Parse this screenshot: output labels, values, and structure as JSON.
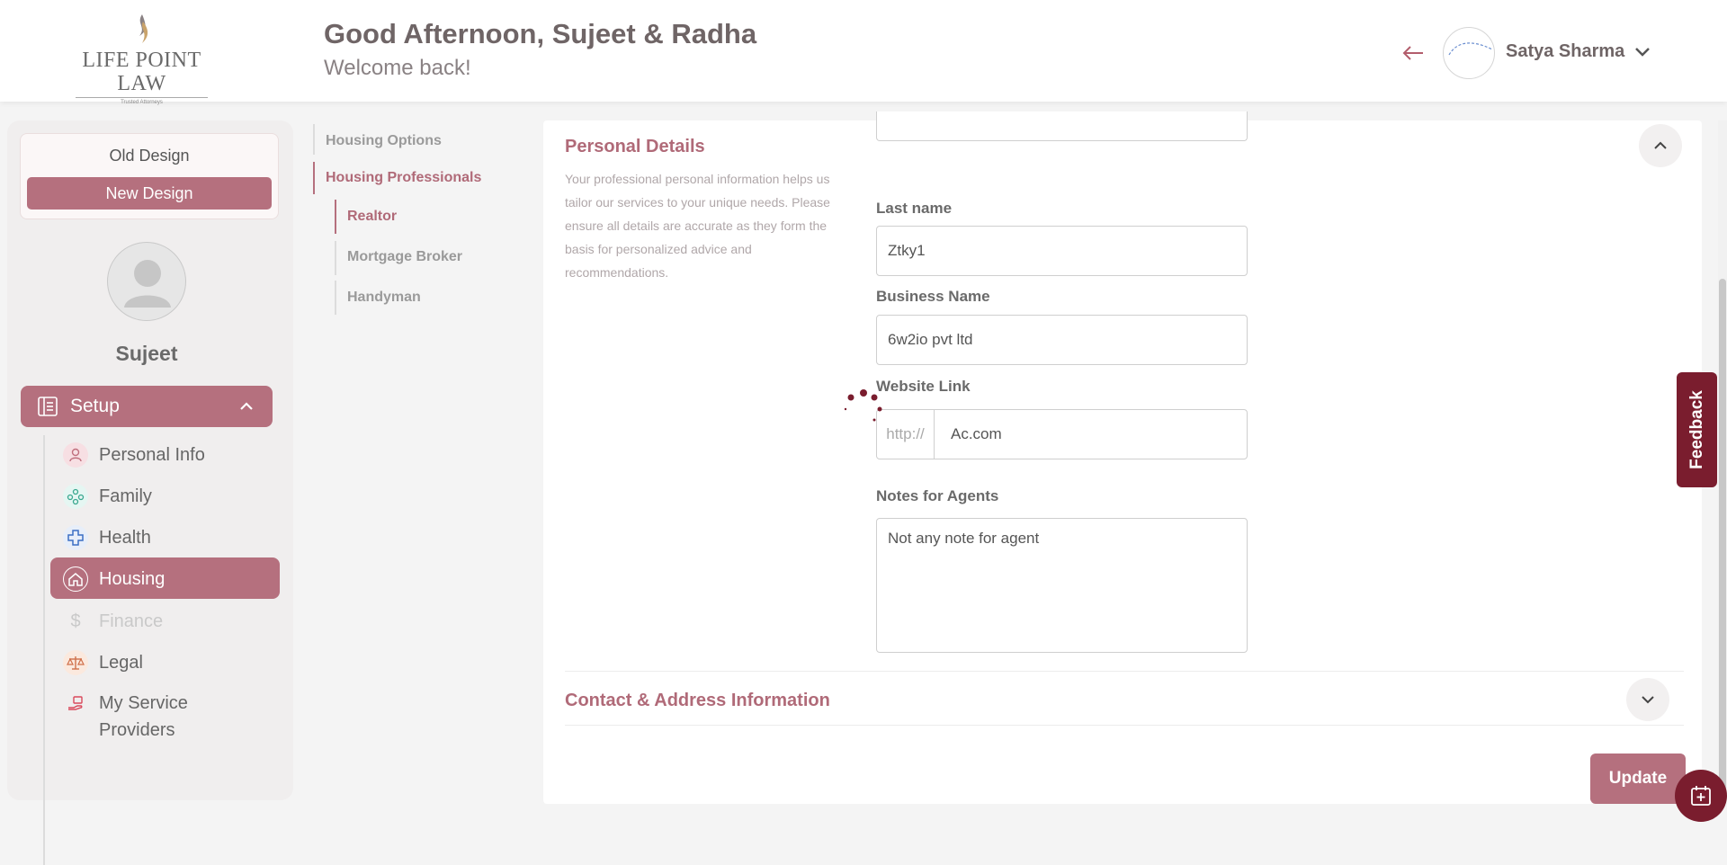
{
  "header": {
    "logo_text": "LIFE POINT LAW",
    "logo_tagline": "Trusted Attorneys",
    "greeting": "Good Afternoon, Sujeet & Radha",
    "welcome": "Welcome back!",
    "user_name": "Satya Sharma"
  },
  "sidebar": {
    "old_design": "Old Design",
    "new_design": "New Design",
    "user_name": "Sujeet",
    "setup_label": "Setup",
    "items": [
      {
        "label": "Personal Info",
        "icon": "person-icon",
        "state": "normal"
      },
      {
        "label": "Family",
        "icon": "family-icon",
        "state": "normal"
      },
      {
        "label": "Health",
        "icon": "health-cross-icon",
        "state": "normal"
      },
      {
        "label": "Housing",
        "icon": "home-icon",
        "state": "active"
      },
      {
        "label": "Finance",
        "icon": "dollar-icon",
        "state": "disabled"
      },
      {
        "label": "Legal",
        "icon": "scales-icon",
        "state": "normal"
      },
      {
        "label": "My Service Providers",
        "icon": "service-hand-icon",
        "state": "normal"
      }
    ]
  },
  "subnav": {
    "housing_options": "Housing Options",
    "housing_professionals": "Housing Professionals",
    "realtor": "Realtor",
    "mortgage_broker": "Mortgage Broker",
    "handyman": "Handyman"
  },
  "form": {
    "section_title": "Personal Details",
    "section_desc": "Your professional personal information helps us tailor our services to your unique needs. Please ensure all details are accurate as they form the basis for personalized advice and recommendations.",
    "last_name_label": "Last name",
    "last_name_value": "Ztky1",
    "business_label": "Business Name",
    "business_value": "6w2io pvt ltd",
    "website_label": "Website Link",
    "website_prefix": "http://",
    "website_value": "Ac.com",
    "notes_label": "Notes for Agents",
    "notes_value": "Not any note for agent",
    "contact_title": "Contact & Address Information",
    "update_label": "Update"
  },
  "feedback_label": "Feedback",
  "colors": {
    "accent": "#b5707e",
    "dark_accent": "#7a1d2e",
    "title": "#b06a78"
  }
}
